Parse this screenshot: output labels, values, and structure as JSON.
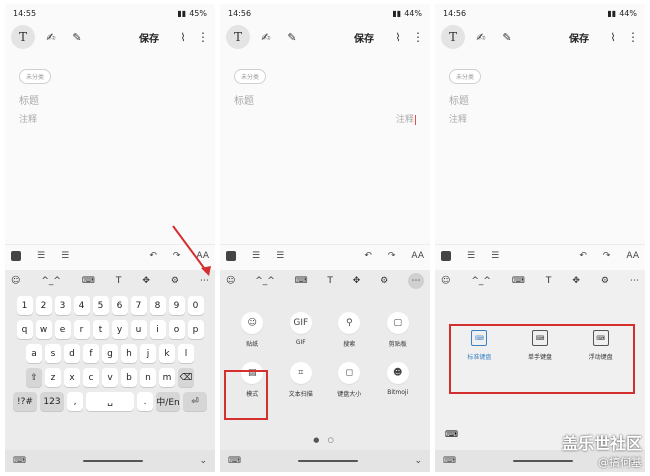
{
  "panels": [
    {
      "status": {
        "time": "14:55",
        "battery": "45%"
      },
      "toolbar": {
        "t_label": "T",
        "save_label": "保存"
      },
      "chip": "未分类",
      "title_placeholder": "标题",
      "note_placeholder": "注释",
      "format_bar": {
        "font_size": "AA"
      },
      "keyboard": {
        "type": "qwerty",
        "number_row": [
          "1",
          "2",
          "3",
          "4",
          "5",
          "6",
          "7",
          "8",
          "9",
          "0"
        ],
        "row1": [
          "q",
          "w",
          "e",
          "r",
          "t",
          "y",
          "u",
          "i",
          "o",
          "p"
        ],
        "row2": [
          "a",
          "s",
          "d",
          "f",
          "g",
          "h",
          "j",
          "k",
          "l"
        ],
        "row3": [
          "z",
          "x",
          "c",
          "v",
          "b",
          "n",
          "m"
        ],
        "bottom": {
          "symbols": "!?#",
          "num": "123",
          "comma": ",",
          "period": ".",
          "lang": "中/En"
        }
      }
    },
    {
      "status": {
        "time": "14:56",
        "battery": "44%"
      },
      "toolbar": {
        "t_label": "T",
        "save_label": "保存"
      },
      "chip": "未分类",
      "title_placeholder": "标题",
      "note_placeholder": "注释",
      "grid_items": [
        {
          "label": "贴纸",
          "icon": "sticker-icon",
          "glyph": "☺"
        },
        {
          "label": "GIF",
          "icon": "gif-icon",
          "glyph": "GIF"
        },
        {
          "label": "搜索",
          "icon": "search-icon",
          "glyph": "⚲"
        },
        {
          "label": "剪贴板",
          "icon": "clipboard-icon",
          "glyph": "▢"
        },
        {
          "label": "模式",
          "icon": "mode-icon",
          "glyph": "▤"
        },
        {
          "label": "文本扫描",
          "icon": "text-scan-icon",
          "glyph": "⌗"
        },
        {
          "label": "键盘大小",
          "icon": "keyboard-size-icon",
          "glyph": "◻"
        },
        {
          "label": "Bitmoji",
          "icon": "bitmoji-icon",
          "glyph": "☻"
        }
      ],
      "pager": "● ○"
    },
    {
      "status": {
        "time": "14:56",
        "battery": "44%"
      },
      "toolbar": {
        "t_label": "T",
        "save_label": "保存"
      },
      "chip": "未分类",
      "title_placeholder": "标题",
      "note_placeholder": "注释",
      "modes": [
        {
          "label": "标准键盘",
          "icon": "standard-keyboard-icon",
          "active": true
        },
        {
          "label": "单手键盘",
          "icon": "one-handed-keyboard-icon",
          "active": false
        },
        {
          "label": "浮动键盘",
          "icon": "floating-keyboard-icon",
          "active": false
        }
      ]
    }
  ],
  "watermark": {
    "line1": "盖乐世社区",
    "line2": "@搞何基"
  },
  "colors": {
    "highlight": "#d32f2f",
    "active_blue": "#3b82c4"
  }
}
